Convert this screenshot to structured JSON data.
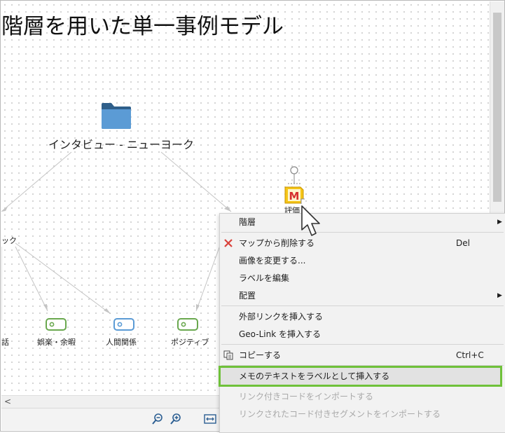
{
  "map": {
    "title": "階層を用いた単一事例モデル",
    "root_node": {
      "label": "インタビュー - ニューヨーク",
      "icon": "folder-icon"
    },
    "left_node": {
      "label": "ック"
    },
    "code_nodes": [
      {
        "label": "話"
      },
      {
        "label": "娯楽・余暇"
      },
      {
        "label": "人間関係"
      },
      {
        "label": "ポジティブ"
      }
    ],
    "memo_node": {
      "label": "評価",
      "icon_letter": "M"
    }
  },
  "context_menu": {
    "items": [
      {
        "label": "階層",
        "shortcut": "",
        "submenu": true,
        "enabled": true,
        "icon": ""
      },
      {
        "label": "マップから削除する",
        "shortcut": "Del",
        "submenu": false,
        "enabled": true,
        "icon": "delete-x-icon"
      },
      {
        "label": "画像を変更する...",
        "shortcut": "",
        "submenu": false,
        "enabled": true,
        "icon": ""
      },
      {
        "label": "ラベルを編集",
        "shortcut": "",
        "submenu": false,
        "enabled": true,
        "icon": ""
      },
      {
        "label": "配置",
        "shortcut": "",
        "submenu": true,
        "enabled": true,
        "icon": ""
      },
      {
        "label": "外部リンクを挿入する",
        "shortcut": "",
        "submenu": false,
        "enabled": true,
        "icon": ""
      },
      {
        "label": "Geo-Link を挿入する",
        "shortcut": "",
        "submenu": false,
        "enabled": true,
        "icon": ""
      },
      {
        "label": "コピーする",
        "shortcut": "Ctrl+C",
        "submenu": false,
        "enabled": true,
        "icon": "copy-icon"
      },
      {
        "label": "メモのテキストをラベルとして挿入する",
        "shortcut": "",
        "submenu": false,
        "enabled": true,
        "highlighted": true,
        "icon": ""
      },
      {
        "label": "リンク付きコードをインポートする",
        "shortcut": "",
        "submenu": false,
        "enabled": false,
        "icon": ""
      },
      {
        "label": "リンクされたコード付きセグメントをインポートする",
        "shortcut": "",
        "submenu": false,
        "enabled": false,
        "icon": ""
      }
    ]
  },
  "scroll": {
    "left_arrow": "<"
  },
  "colors": {
    "highlight_outline": "#6fc13a",
    "folder": "#5b9bd5",
    "code_green": "#6aa84f",
    "code_blue": "#5b9bd5",
    "memo_yellow": "#f5c518",
    "memo_red": "#d62f2f",
    "delete_red": "#d9413a"
  }
}
